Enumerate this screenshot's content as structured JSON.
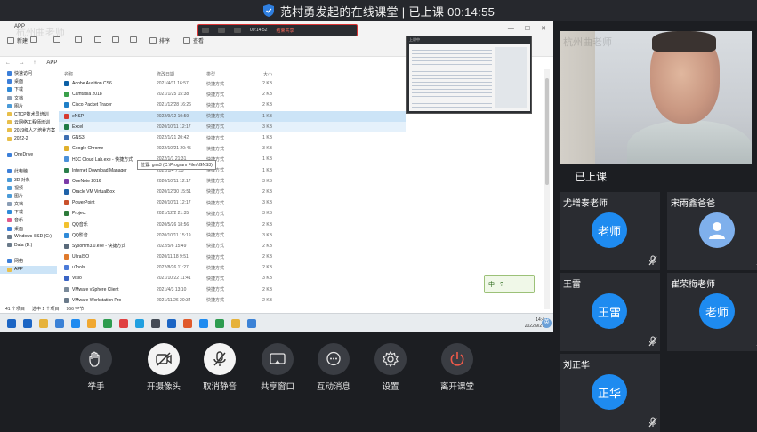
{
  "window": {
    "title": "范村勇发起的在线课堂 | 已上课 00:14:55"
  },
  "shared_screen": {
    "app_title": "APP",
    "watermark": "杭州曲老师",
    "toolbar": [
      {
        "label": "新建",
        "icon": "new-icon"
      },
      {
        "label": "",
        "icon": "cut-icon"
      },
      {
        "label": "",
        "icon": "copy-icon"
      },
      {
        "label": "",
        "icon": "paste-icon"
      },
      {
        "label": "",
        "icon": "rename-icon"
      },
      {
        "label": "",
        "icon": "share-icon"
      },
      {
        "label": "",
        "icon": "delete-icon"
      },
      {
        "label": "排序",
        "icon": "sort-icon"
      },
      {
        "label": "查看",
        "icon": "view-icon"
      }
    ],
    "meeting_bar": {
      "items": [
        "",
        "",
        "",
        "00:14:52",
        "结束共享"
      ]
    },
    "address": {
      "path": "APP",
      "arrows": "← → ↑"
    },
    "nav_items": [
      {
        "label": "快速访问",
        "color": "#3c7fd9"
      },
      {
        "label": "桌面",
        "color": "#3c7fd9"
      },
      {
        "label": "下载",
        "color": "#2f8ad8"
      },
      {
        "label": "文档",
        "color": "#8a9db5"
      },
      {
        "label": "图片",
        "color": "#4b9bd8"
      },
      {
        "label": "CTCP技术员培训",
        "color": "#e8bf4b"
      },
      {
        "label": "云网络工程师培训",
        "color": "#e8bf4b"
      },
      {
        "label": "2019级人才培养方案",
        "color": "#e8bf4b"
      },
      {
        "label": "2022-2",
        "color": "#e8bf4b"
      },
      {
        "label": "",
        "color": "#ffffff"
      },
      {
        "label": "OneDrive",
        "color": "#3c7fd9"
      },
      {
        "label": "",
        "color": "#ffffff"
      },
      {
        "label": "此电脑",
        "color": "#3c7fd9"
      },
      {
        "label": "3D 对象",
        "color": "#4b9bd8"
      },
      {
        "label": "视频",
        "color": "#4b9bd8"
      },
      {
        "label": "图片",
        "color": "#4b9bd8"
      },
      {
        "label": "文档",
        "color": "#8a9db5"
      },
      {
        "label": "下载",
        "color": "#2f8ad8"
      },
      {
        "label": "音乐",
        "color": "#e05a8c"
      },
      {
        "label": "桌面",
        "color": "#3c7fd9"
      },
      {
        "label": "Windows-SSD (C:)",
        "color": "#6a7a8a"
      },
      {
        "label": "Data (D:)",
        "color": "#6a7a8a"
      },
      {
        "label": "",
        "color": "#ffffff"
      },
      {
        "label": "网络",
        "color": "#3c7fd9"
      },
      {
        "label": "APP",
        "color": "#e8bf4b"
      }
    ],
    "file_headers": {
      "name": "名称",
      "date": "修改日期",
      "type": "类型",
      "size": "大小"
    },
    "files": [
      {
        "name": "Adobe Audition CS6",
        "date": "2021/4/11 16:57",
        "type": "快捷方式",
        "size": "2 KB",
        "color": "#0b5fa5"
      },
      {
        "name": "Camtasia 2018",
        "date": "2021/1/25 15:38",
        "type": "快捷方式",
        "size": "2 KB",
        "color": "#3aa04a"
      },
      {
        "name": "Cisco Packet Tracer",
        "date": "2021/12/28 16:26",
        "type": "快捷方式",
        "size": "2 KB",
        "color": "#1f7fc7"
      },
      {
        "name": "eNSP",
        "date": "2022/9/12 10:59",
        "type": "快捷方式",
        "size": "1 KB",
        "color": "#d63a2f"
      },
      {
        "name": "Excel",
        "date": "2020/10/11 12:17",
        "type": "快捷方式",
        "size": "3 KB",
        "color": "#1e7a45"
      },
      {
        "name": "GNS3",
        "date": "2022/1/21 20:42",
        "type": "快捷方式",
        "size": "1 KB",
        "color": "#3e6fb2"
      },
      {
        "name": "Google Chrome",
        "date": "2022/10/21 20:45",
        "type": "快捷方式",
        "size": "3 KB",
        "color": "#e0b02c"
      },
      {
        "name": "H3C Cloud Lab.exe - 快捷方式",
        "date": "2022/1/1 21:31",
        "type": "快捷方式",
        "size": "1 KB",
        "color": "#4a90d9"
      },
      {
        "name": "Internet Download Manager",
        "date": "2021/1/4 7:55",
        "type": "快捷方式",
        "size": "1 KB",
        "color": "#2a7f4a"
      },
      {
        "name": "OneNote 2016",
        "date": "2020/10/11 12:17",
        "type": "快捷方式",
        "size": "3 KB",
        "color": "#7b3aa8"
      },
      {
        "name": "Oracle VM VirtualBox",
        "date": "2020/12/30 15:51",
        "type": "快捷方式",
        "size": "2 KB",
        "color": "#1f62a8"
      },
      {
        "name": "PowerPoint",
        "date": "2020/10/11 12:17",
        "type": "快捷方式",
        "size": "3 KB",
        "color": "#c9502b"
      },
      {
        "name": "Project",
        "date": "2021/12/2 21:35",
        "type": "快捷方式",
        "size": "3 KB",
        "color": "#2d7b3a"
      },
      {
        "name": "QQ音乐",
        "date": "2020/5/26 18:56",
        "type": "快捷方式",
        "size": "2 KB",
        "color": "#f2c12e"
      },
      {
        "name": "QQ影音",
        "date": "2020/10/11 15:19",
        "type": "快捷方式",
        "size": "3 KB",
        "color": "#2f8ad8"
      },
      {
        "name": "Sysomm3.0.exe - 快捷方式",
        "date": "2022/5/6 15:49",
        "type": "快捷方式",
        "size": "2 KB",
        "color": "#5a6a7a"
      },
      {
        "name": "UltraISO",
        "date": "2020/11/18 9:51",
        "type": "快捷方式",
        "size": "2 KB",
        "color": "#e07a2b"
      },
      {
        "name": "uTools",
        "date": "2022/8/26 11:27",
        "type": "快捷方式",
        "size": "2 KB",
        "color": "#4b7bd8"
      },
      {
        "name": "Visio",
        "date": "2021/10/22 11:41",
        "type": "快捷方式",
        "size": "3 KB",
        "color": "#3a64c4"
      },
      {
        "name": "VMware vSphere Client",
        "date": "2021/4/3 13:10",
        "type": "快捷方式",
        "size": "2 KB",
        "color": "#7a8a9a"
      },
      {
        "name": "VMware Workstation Pro",
        "date": "2021/11/26 20:34",
        "type": "快捷方式",
        "size": "2 KB",
        "color": "#6a7a8a"
      }
    ],
    "tooltip": "位置: gns3 (C:\\Program Files\\GNS3)",
    "status": [
      "41 个项目",
      "选中 1 个项目",
      "966 字节"
    ],
    "ime_badge": "中 ?",
    "thumbnail_title": "上课中",
    "taskbar": {
      "tray_lines": [
        "14:4",
        "2022/9/27"
      ],
      "ime": "英",
      "apps": [
        "#1c66c4",
        "#e6b23a",
        "#3b82d6",
        "#1e8bf0",
        "#f0a830",
        "#2d9c4f",
        "#e04040",
        "#20a0e0",
        "#444b55",
        "#1c66c4",
        "#e05a2b",
        "#1e8bf0",
        "#2d9c4f",
        "#e6b23a",
        "#3b82d6"
      ]
    }
  },
  "participants": {
    "self_watermark": "杭州曲老师",
    "on_stage_label": "已上课",
    "tiles": [
      {
        "name": "尤增泰老师",
        "avatar": "老师",
        "guest": false,
        "muted": true
      },
      {
        "name": "宋雨鑫爸爸",
        "avatar": "",
        "guest": true,
        "muted": true
      },
      {
        "name": "王雷",
        "avatar": "王雷",
        "guest": false,
        "muted": true
      },
      {
        "name": "崔荣梅老师",
        "avatar": "老师",
        "guest": false,
        "muted": true
      },
      {
        "name": "刘正华",
        "avatar": "正华",
        "guest": false,
        "muted": true
      }
    ]
  },
  "toolbar": {
    "buttons": [
      {
        "label": "举手",
        "icon": "raise-hand-icon"
      },
      {
        "label": "开摄像头",
        "icon": "camera-off-icon"
      },
      {
        "label": "取消静音",
        "icon": "mic-off-icon"
      },
      {
        "label": "共享窗口",
        "icon": "share-screen-icon"
      },
      {
        "label": "互动消息",
        "icon": "chat-icon"
      },
      {
        "label": "设置",
        "icon": "settings-icon"
      },
      {
        "label": "离开课堂",
        "icon": "leave-icon"
      }
    ]
  }
}
